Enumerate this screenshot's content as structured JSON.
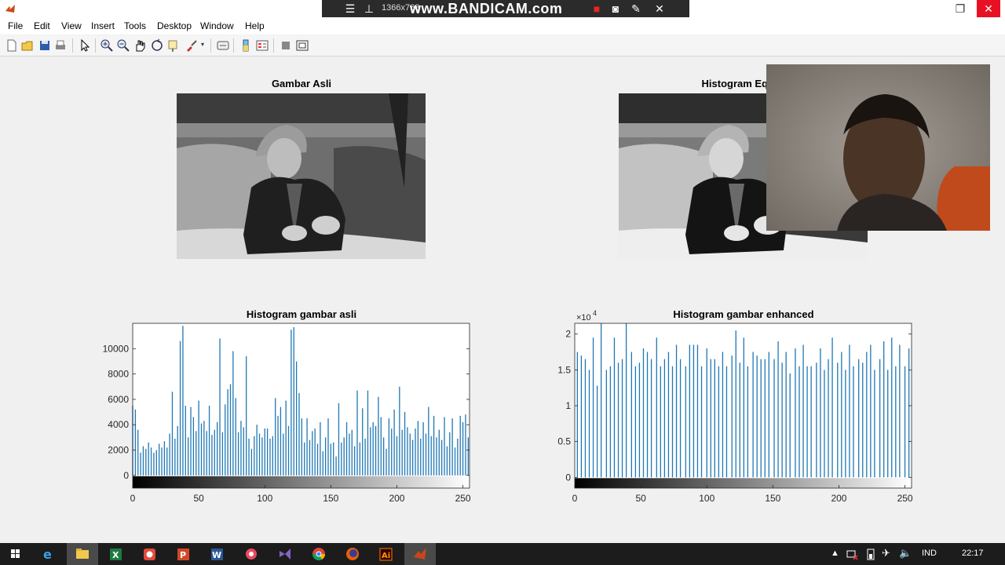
{
  "window": {
    "minimize": "–",
    "restore": "❐",
    "close": "✕"
  },
  "recorder": {
    "resolution": "1366x768",
    "brand": "www.BANDICAM.com"
  },
  "menu": [
    "File",
    "Edit",
    "View",
    "Insert",
    "Tools",
    "Desktop",
    "Window",
    "Help"
  ],
  "toolbar": {
    "icons": [
      "new-figure-icon",
      "open-file-icon",
      "save-icon",
      "print-icon",
      "edit-plot-icon",
      "zoom-in-icon",
      "zoom-out-icon",
      "pan-icon",
      "rotate-3d-icon",
      "data-cursor-icon",
      "brush-icon",
      "link-plot-icon",
      "colorbar-icon",
      "legend-icon",
      "hide-plot-tools-icon",
      "show-plot-tools-icon"
    ]
  },
  "axes": {
    "original_image_title": "Gambar Asli",
    "equalized_image_title": "Histogram Equali",
    "hist_original_title": "Histogram gambar asli",
    "hist_enhanced_title": "Histogram gambar enhanced"
  },
  "chart_data": [
    {
      "type": "bar",
      "title": "Histogram gambar asli",
      "xlabel": "",
      "ylabel": "",
      "xlim": [
        0,
        255
      ],
      "ylim": [
        -1000,
        12000
      ],
      "xticks": [
        0,
        50,
        100,
        150,
        200,
        250
      ],
      "yticks": [
        0,
        2000,
        4000,
        6000,
        8000,
        10000
      ],
      "ytick_labels": [
        "0",
        "2000",
        "4000",
        "6000",
        "8000",
        "10000"
      ],
      "bar_color": "#1f77b4",
      "colorbar": "gray",
      "x": [
        0,
        2,
        4,
        6,
        8,
        10,
        12,
        14,
        16,
        18,
        20,
        22,
        24,
        26,
        28,
        30,
        32,
        34,
        36,
        38,
        40,
        42,
        44,
        46,
        48,
        50,
        52,
        54,
        56,
        58,
        60,
        62,
        64,
        66,
        68,
        70,
        72,
        74,
        76,
        78,
        80,
        82,
        84,
        86,
        88,
        90,
        92,
        94,
        96,
        98,
        100,
        102,
        104,
        106,
        108,
        110,
        112,
        114,
        116,
        118,
        120,
        122,
        124,
        126,
        128,
        130,
        132,
        134,
        136,
        138,
        140,
        142,
        144,
        146,
        148,
        150,
        152,
        154,
        156,
        158,
        160,
        162,
        164,
        166,
        168,
        170,
        172,
        174,
        176,
        178,
        180,
        182,
        184,
        186,
        188,
        190,
        192,
        194,
        196,
        198,
        200,
        202,
        204,
        206,
        208,
        210,
        212,
        214,
        216,
        218,
        220,
        222,
        224,
        226,
        228,
        230,
        232,
        234,
        236,
        238,
        240,
        242,
        244,
        246,
        248,
        250,
        252,
        254
      ],
      "values": [
        5500,
        5200,
        3600,
        1800,
        2300,
        2100,
        2600,
        2200,
        1800,
        2000,
        2500,
        2200,
        2700,
        2200,
        3300,
        6600,
        2900,
        3900,
        10600,
        11800,
        5500,
        3000,
        5400,
        4600,
        3500,
        5900,
        4100,
        4300,
        3500,
        5500,
        3200,
        3600,
        4200,
        10800,
        3400,
        5600,
        6800,
        7200,
        9800,
        6100,
        3400,
        4300,
        3800,
        9400,
        2900,
        2100,
        3100,
        4000,
        3300,
        3000,
        3700,
        3700,
        2900,
        3100,
        6100,
        4700,
        5400,
        3300,
        5900,
        3900,
        11500,
        11700,
        9000,
        6500,
        4500,
        2600,
        4500,
        2800,
        3500,
        3700,
        2500,
        4200,
        1900,
        3000,
        4500,
        2500,
        2600,
        1500,
        5700,
        2600,
        3000,
        4200,
        3300,
        3600,
        2300,
        6700,
        2600,
        5300,
        2900,
        6700,
        3800,
        4200,
        3900,
        6200,
        4600,
        3000,
        2100,
        4500,
        3700,
        5200,
        3100,
        7000,
        3600,
        5000,
        3800,
        3300,
        2800,
        3700,
        4300,
        2900,
        4200,
        3300,
        5400,
        3100,
        4700,
        3000,
        3600,
        2800,
        4600,
        2300,
        3400,
        4500,
        2200,
        2900,
        4700,
        4200,
        4800,
        3000
      ]
    },
    {
      "type": "bar",
      "title": "Histogram gambar enhanced",
      "xlabel": "",
      "ylabel": "",
      "xlim": [
        0,
        255
      ],
      "ylim": [
        -0.15,
        2.15
      ],
      "xticks": [
        0,
        50,
        100,
        150,
        200,
        250
      ],
      "yticks": [
        0,
        0.5,
        1,
        1.5,
        2
      ],
      "ytick_labels": [
        "0",
        "0.5",
        "1",
        "1.5",
        "2"
      ],
      "y_multiplier": "×10",
      "y_multiplier_exp": "4",
      "bar_color": "#1f77b4",
      "colorbar": "gray",
      "x": [
        2,
        5,
        8,
        11,
        14,
        17,
        20,
        24,
        27,
        30,
        33,
        36,
        39,
        43,
        46,
        49,
        52,
        55,
        58,
        62,
        65,
        68,
        71,
        74,
        77,
        80,
        84,
        87,
        90,
        93,
        96,
        100,
        103,
        106,
        109,
        112,
        115,
        119,
        122,
        125,
        128,
        131,
        135,
        138,
        141,
        144,
        147,
        151,
        154,
        157,
        160,
        163,
        167,
        170,
        173,
        176,
        179,
        183,
        186,
        189,
        192,
        195,
        199,
        202,
        205,
        208,
        211,
        215,
        218,
        221,
        224,
        227,
        231,
        234,
        237,
        240,
        243,
        246,
        250,
        253
      ],
      "values": [
        1.75,
        1.7,
        1.65,
        1.5,
        1.95,
        1.28,
        2.15,
        1.5,
        1.55,
        1.95,
        1.6,
        1.65,
        2.15,
        1.75,
        1.55,
        1.6,
        1.8,
        1.75,
        1.65,
        1.95,
        1.55,
        1.65,
        1.75,
        1.55,
        1.85,
        1.65,
        1.55,
        1.85,
        1.85,
        1.85,
        1.55,
        1.8,
        1.65,
        1.65,
        1.55,
        1.75,
        1.55,
        1.7,
        2.05,
        1.6,
        1.95,
        1.55,
        1.75,
        1.7,
        1.65,
        1.65,
        1.75,
        1.65,
        1.9,
        1.6,
        1.75,
        1.45,
        1.8,
        1.55,
        1.85,
        1.55,
        1.55,
        1.6,
        1.8,
        1.5,
        1.65,
        1.95,
        1.6,
        1.75,
        1.5,
        1.85,
        1.55,
        1.65,
        1.6,
        1.75,
        1.85,
        1.5,
        1.65,
        1.9,
        1.5,
        1.95,
        1.55,
        1.85,
        1.55,
        1.8
      ]
    }
  ],
  "taskbar": {
    "apps": [
      "windows-start-icon",
      "internet-explorer-icon",
      "file-explorer-icon",
      "excel-icon",
      "screen-recorder-icon",
      "powerpoint-icon",
      "word-icon",
      "media-icon",
      "visual-studio-icon",
      "chrome-icon",
      "firefox-icon",
      "illustrator-icon",
      "matlab-icon"
    ],
    "language": "IND",
    "time": "22:17"
  }
}
